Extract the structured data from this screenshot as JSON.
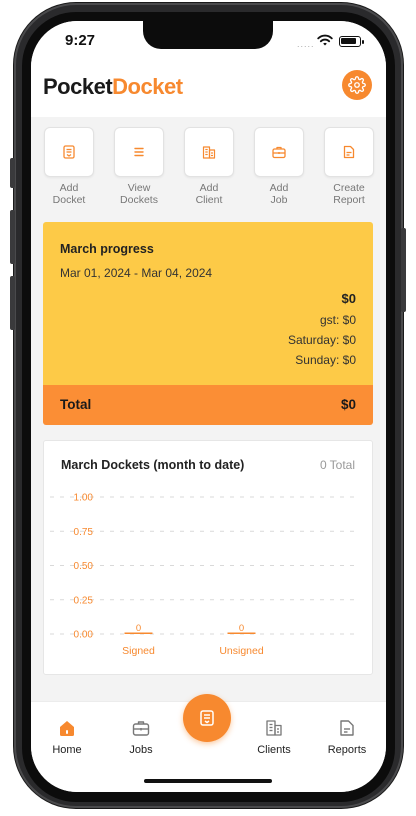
{
  "status_bar": {
    "time": "9:27",
    "signal": "....."
  },
  "header": {
    "logo_part1": "Pocket",
    "logo_part2": "Docket"
  },
  "quick_actions": [
    {
      "label": "Add\nDocket",
      "icon": "docket-icon"
    },
    {
      "label": "View\nDockets",
      "icon": "list-icon"
    },
    {
      "label": "Add\nClient",
      "icon": "building-icon"
    },
    {
      "label": "Add\nJob",
      "icon": "briefcase-icon"
    },
    {
      "label": "Create\nReport",
      "icon": "report-icon"
    }
  ],
  "progress": {
    "title": "March progress",
    "range": "Mar 01, 2024 - Mar 04, 2024",
    "amount": "$0",
    "gst": "gst: $0",
    "saturday": "Saturday: $0",
    "sunday": "Sunday: $0",
    "total_label": "Total",
    "total_value": "$0"
  },
  "dockets_chart": {
    "title": "March Dockets (month to date)",
    "total_value": "0",
    "total_suffix": "Total"
  },
  "chart_data": {
    "type": "bar",
    "categories": [
      "Signed",
      "Unsigned"
    ],
    "values": [
      0,
      0
    ],
    "data_labels": [
      "0",
      "0"
    ],
    "yticks": [
      "1.00",
      "0.75",
      "0.50",
      "0.25",
      "0.00"
    ],
    "ylim": [
      0,
      1
    ],
    "grid": true,
    "colors": {
      "bar": "#f7892f",
      "tick": "#f7892f",
      "grid": "#d9d9d9"
    }
  },
  "tabbar": {
    "items": [
      {
        "label": "Home",
        "icon": "home-icon",
        "active": true
      },
      {
        "label": "Jobs",
        "icon": "briefcase-icon"
      },
      {
        "label": "Clients",
        "icon": "building-icon"
      },
      {
        "label": "Reports",
        "icon": "report-icon"
      }
    ],
    "fab_icon": "receipt-icon"
  },
  "colors": {
    "accent": "#f7892f",
    "progress_bg": "#fdca47",
    "total_bg": "#fb8e35"
  }
}
